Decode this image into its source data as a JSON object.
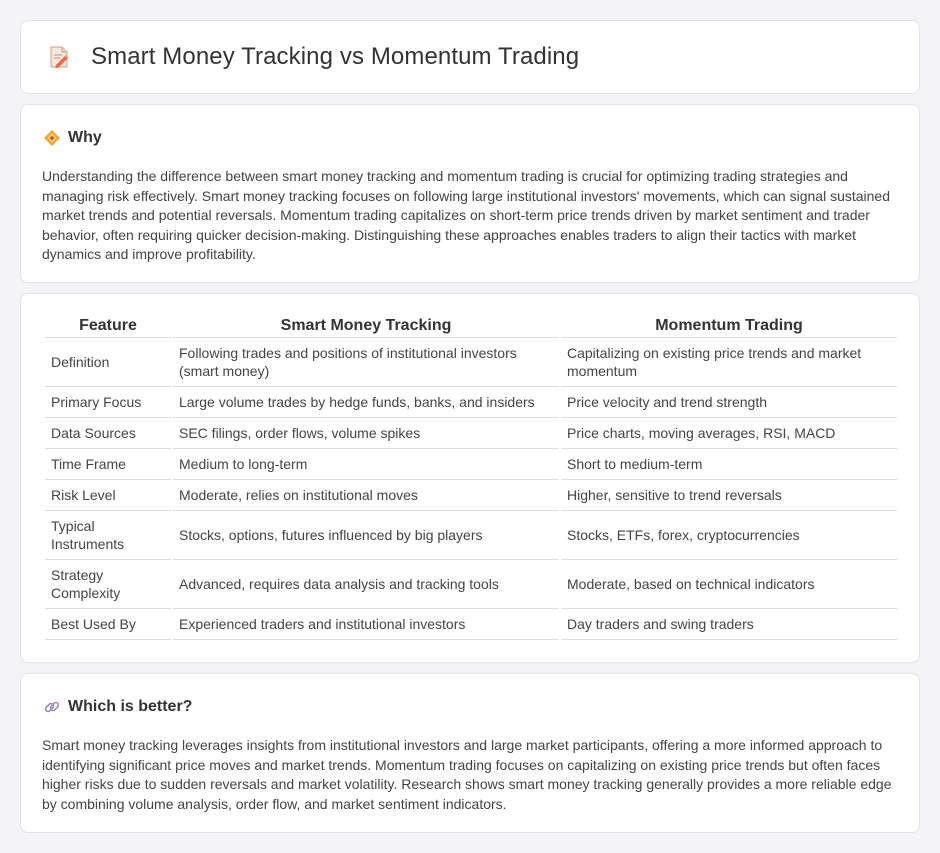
{
  "header": {
    "title": "Smart Money Tracking vs Momentum Trading",
    "icon": "document-pencil-icon"
  },
  "why": {
    "icon": "diamond-icon",
    "heading": "Why",
    "text": "Understanding the difference between smart money tracking and momentum trading is crucial for optimizing trading strategies and managing risk effectively. Smart money tracking focuses on following large institutional investors' movements, which can signal sustained market trends and potential reversals. Momentum trading capitalizes on short-term price trends driven by market sentiment and trader behavior, often requiring quicker decision-making. Distinguishing these approaches enables traders to align their tactics with market dynamics and improve profitability."
  },
  "table": {
    "headers": [
      "Feature",
      "Smart Money Tracking",
      "Momentum Trading"
    ],
    "rows": [
      [
        "Definition",
        "Following trades and positions of institutional investors (smart money)",
        "Capitalizing on existing price trends and market momentum"
      ],
      [
        "Primary Focus",
        "Large volume trades by hedge funds, banks, and insiders",
        "Price velocity and trend strength"
      ],
      [
        "Data Sources",
        "SEC filings, order flows, volume spikes",
        "Price charts, moving averages, RSI, MACD"
      ],
      [
        "Time Frame",
        "Medium to long-term",
        "Short to medium-term"
      ],
      [
        "Risk Level",
        "Moderate, relies on institutional moves",
        "Higher, sensitive to trend reversals"
      ],
      [
        "Typical Instruments",
        "Stocks, options, futures influenced by big players",
        "Stocks, ETFs, forex, cryptocurrencies"
      ],
      [
        "Strategy Complexity",
        "Advanced, requires data analysis and tracking tools",
        "Moderate, based on technical indicators"
      ],
      [
        "Best Used By",
        "Experienced traders and institutional investors",
        "Day traders and swing traders"
      ]
    ]
  },
  "better": {
    "icon": "link-icon",
    "heading": "Which is better?",
    "text": "Smart money tracking leverages insights from institutional investors and large market participants, offering a more informed approach to identifying significant price moves and market trends. Momentum trading focuses on capitalizing on existing price trends but often faces higher risks due to sudden reversals and market volatility. Research shows smart money tracking generally provides a more reliable edge by combining volume analysis, order flow, and market sentiment indicators."
  }
}
